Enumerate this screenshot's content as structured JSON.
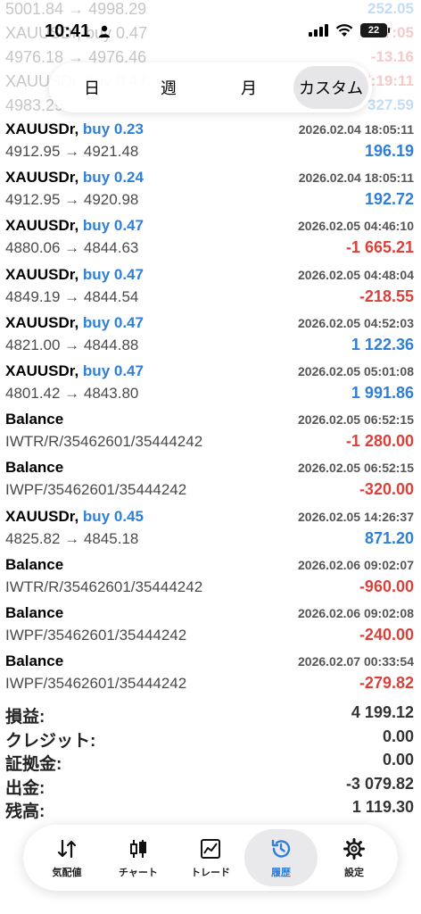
{
  "status_bar": {
    "time": "10:41",
    "battery": "22"
  },
  "ghost_rows": [
    {
      "left": "5001.84 → 4998.29",
      "right": "252.05",
      "cls": "pos"
    },
    {
      "left": "XAUUSDr, buy 0.47",
      "right": "17:05",
      "cls": "neg"
    },
    {
      "left": "4976.18 → 4976.46",
      "right": "-13.16",
      "cls": "neg"
    },
    {
      "left": "XAUUSDr, buy 0.47",
      "right": "17:19:11",
      "cls": "neg"
    },
    {
      "left": "4983.29",
      "right": "327.59",
      "cls": "pos"
    }
  ],
  "tabs": [
    "日",
    "週",
    "月",
    "カスタム"
  ],
  "deals": [
    {
      "symbol": "XAUUSDr,",
      "direction": "buy 0.23",
      "date": "2026.02.04 18:05:11",
      "detail": "4912.95 → 4921.48",
      "amount": "196.19",
      "sign": "pos"
    },
    {
      "symbol": "XAUUSDr,",
      "direction": "buy 0.24",
      "date": "2026.02.04 18:05:11",
      "detail": "4912.95 → 4920.98",
      "amount": "192.72",
      "sign": "pos"
    },
    {
      "symbol": "XAUUSDr,",
      "direction": "buy 0.47",
      "date": "2026.02.05 04:46:10",
      "detail": "4880.06 → 4844.63",
      "amount": "-1 665.21",
      "sign": "neg"
    },
    {
      "symbol": "XAUUSDr,",
      "direction": "buy 0.47",
      "date": "2026.02.05 04:48:04",
      "detail": "4849.19 → 4844.54",
      "amount": "-218.55",
      "sign": "neg"
    },
    {
      "symbol": "XAUUSDr,",
      "direction": "buy 0.47",
      "date": "2026.02.05 04:52:03",
      "detail": "4821.00 → 4844.88",
      "amount": "1 122.36",
      "sign": "pos"
    },
    {
      "symbol": "XAUUSDr,",
      "direction": "buy 0.47",
      "date": "2026.02.05 05:01:08",
      "detail": "4801.42 → 4843.80",
      "amount": "1 991.86",
      "sign": "pos"
    },
    {
      "symbol": "Balance",
      "direction": "",
      "date": "2026.02.05 06:52:15",
      "detail": "IWTR/R/35462601/35444242",
      "amount": "-1 280.00",
      "sign": "neg"
    },
    {
      "symbol": "Balance",
      "direction": "",
      "date": "2026.02.05 06:52:15",
      "detail": "IWPF/35462601/35444242",
      "amount": "-320.00",
      "sign": "neg"
    },
    {
      "symbol": "XAUUSDr,",
      "direction": "buy 0.45",
      "date": "2026.02.05 14:26:37",
      "detail": "4825.82 → 4845.18",
      "amount": "871.20",
      "sign": "pos"
    },
    {
      "symbol": "Balance",
      "direction": "",
      "date": "2026.02.06 09:02:07",
      "detail": "IWTR/R/35462601/35444242",
      "amount": "-960.00",
      "sign": "neg"
    },
    {
      "symbol": "Balance",
      "direction": "",
      "date": "2026.02.06 09:02:08",
      "detail": "IWPF/35462601/35444242",
      "amount": "-240.00",
      "sign": "neg"
    },
    {
      "symbol": "Balance",
      "direction": "",
      "date": "2026.02.07 00:33:54",
      "detail": "IWPF/35462601/35444242",
      "amount": "-279.82",
      "sign": "neg"
    }
  ],
  "summary": [
    {
      "label": "損益:",
      "value": "4 199.12"
    },
    {
      "label": "クレジット:",
      "value": "0.00"
    },
    {
      "label": "証拠金:",
      "value": "0.00"
    },
    {
      "label": "出金:",
      "value": "-3 079.82"
    },
    {
      "label": "残高:",
      "value": "1 119.30"
    }
  ],
  "nav": [
    {
      "label": "気配値",
      "icon": "quotes-arrows-icon"
    },
    {
      "label": "チャート",
      "icon": "candlestick-chart-icon"
    },
    {
      "label": "トレード",
      "icon": "trade-line-chart-icon"
    },
    {
      "label": "履歴",
      "icon": "history-clock-icon",
      "active": true
    },
    {
      "label": "設定",
      "icon": "gear-icon"
    }
  ],
  "colors": {
    "positive": "#2f7fd8",
    "negative": "#d9423a",
    "accent": "#2f7fd8"
  }
}
